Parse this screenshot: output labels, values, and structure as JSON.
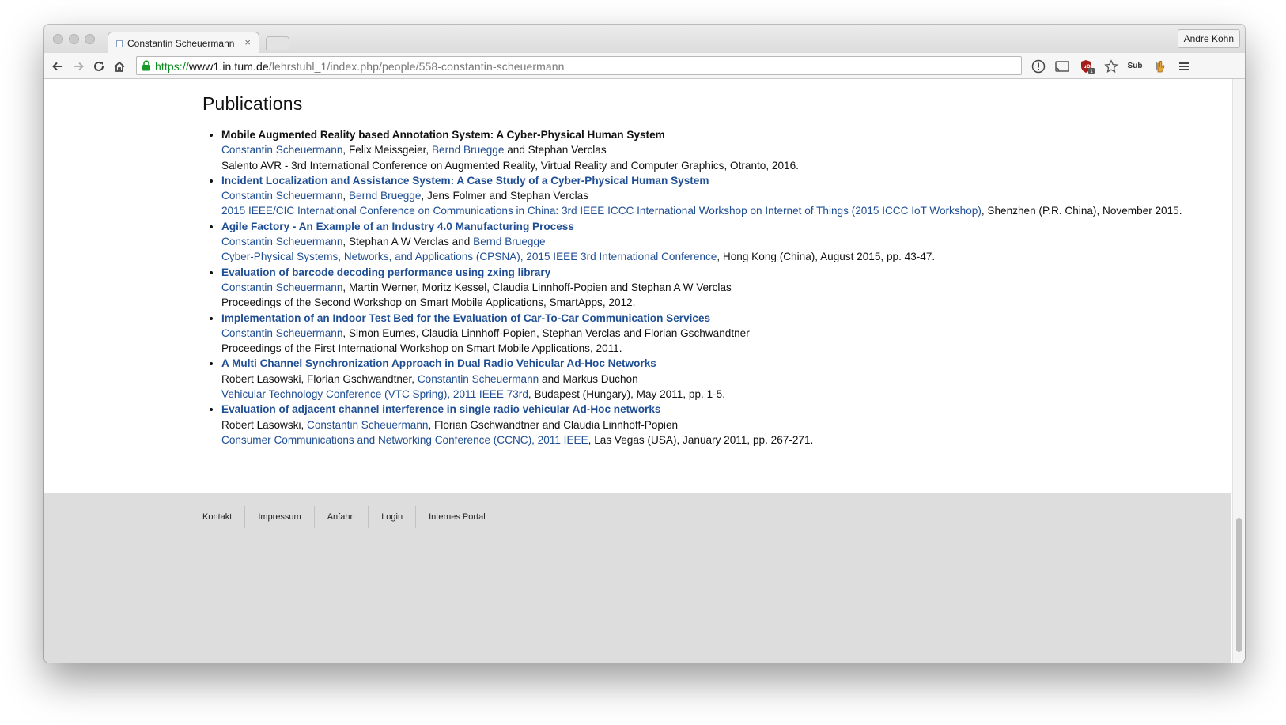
{
  "browser": {
    "tab_title": "Constantin Scheuermann",
    "tab_close": "×",
    "profile_name": "Andre Kohn",
    "url_scheme": "https://",
    "url_host": "www1.in.tum.de",
    "url_path": "/lehrstuhl_1/index.php/people/558-constantin-scheuermann",
    "extensions": [
      "info-icon",
      "cast-icon",
      "ublock-icon",
      "star-icon",
      "sub-icon",
      "hand-icon",
      "menu-icon"
    ],
    "ublock_badge": "1",
    "sub_label": "Sub"
  },
  "page": {
    "heading": "Publications",
    "publications": [
      {
        "title": "Mobile Augmented Reality based Annotation System: A Cyber-Physical Human System",
        "title_link": false,
        "authors": [
          {
            "text": "Constantin Scheuermann",
            "link": true
          },
          {
            "text": ", Felix Meissgeier, ",
            "link": false
          },
          {
            "text": "Bernd Bruegge",
            "link": true
          },
          {
            "text": " and Stephan Verclas",
            "link": false
          }
        ],
        "venue": [
          {
            "text": "Salento AVR - 3rd International Conference on Augmented Reality, Virtual Reality and Computer Graphics, Otranto, 2016.",
            "link": false
          }
        ]
      },
      {
        "title": "Incident Localization and Assistance System: A Case Study of a Cyber-Physical Human System",
        "title_link": true,
        "authors": [
          {
            "text": "Constantin Scheuermann",
            "link": true
          },
          {
            "text": ", ",
            "link": false
          },
          {
            "text": "Bernd Bruegge",
            "link": true
          },
          {
            "text": ", Jens Folmer and Stephan Verclas",
            "link": false
          }
        ],
        "venue": [
          {
            "text": "2015 IEEE/CIC International Conference on Communications in China: 3rd IEEE ICCC International Workshop on Internet of Things (2015 ICCC IoT Workshop)",
            "link": true
          },
          {
            "text": ", Shenzhen (P.R. China), November 2015.",
            "link": false
          }
        ]
      },
      {
        "title": "Agile Factory - An Example of an Industry 4.0 Manufacturing Process",
        "title_link": true,
        "authors": [
          {
            "text": "Constantin Scheuermann",
            "link": true
          },
          {
            "text": ", Stephan A W Verclas and ",
            "link": false
          },
          {
            "text": "Bernd Bruegge",
            "link": true
          }
        ],
        "venue": [
          {
            "text": "Cyber-Physical Systems, Networks, and Applications (CPSNA), 2015 IEEE 3rd International Conference",
            "link": true
          },
          {
            "text": ", Hong Kong (China), August 2015, pp. 43-47.",
            "link": false
          }
        ]
      },
      {
        "title": "Evaluation of barcode decoding performance using zxing library",
        "title_link": true,
        "authors": [
          {
            "text": "Constantin Scheuermann",
            "link": true
          },
          {
            "text": ", Martin Werner, Moritz Kessel, Claudia Linnhoff-Popien and Stephan A W Verclas",
            "link": false
          }
        ],
        "venue": [
          {
            "text": "Proceedings of the Second Workshop on Smart Mobile Applications, SmartApps, 2012.",
            "link": false
          }
        ]
      },
      {
        "title": "Implementation of an Indoor Test Bed for the Evaluation of Car-To-Car Communication Services",
        "title_link": true,
        "authors": [
          {
            "text": "Constantin Scheuermann",
            "link": true
          },
          {
            "text": ", Simon Eumes, Claudia Linnhoff-Popien, Stephan Verclas and Florian Gschwandtner",
            "link": false
          }
        ],
        "venue": [
          {
            "text": "Proceedings of the First International Workshop on Smart Mobile Applications, 2011.",
            "link": false
          }
        ]
      },
      {
        "title": "A Multi Channel Synchronization Approach in Dual Radio Vehicular Ad-Hoc Networks",
        "title_link": true,
        "authors": [
          {
            "text": "Robert Lasowski, Florian Gschwandtner, ",
            "link": false
          },
          {
            "text": "Constantin Scheuermann",
            "link": true
          },
          {
            "text": " and Markus Duchon",
            "link": false
          }
        ],
        "venue": [
          {
            "text": "Vehicular Technology Conference (VTC Spring), 2011 IEEE 73rd",
            "link": true
          },
          {
            "text": ", Budapest (Hungary), May 2011, pp. 1-5.",
            "link": false
          }
        ]
      },
      {
        "title": "Evaluation of adjacent channel interference in single radio vehicular Ad-Hoc networks",
        "title_link": true,
        "authors": [
          {
            "text": "Robert Lasowski, ",
            "link": false
          },
          {
            "text": "Constantin Scheuermann",
            "link": true
          },
          {
            "text": ", Florian Gschwandtner and Claudia Linnhoff-Popien",
            "link": false
          }
        ],
        "venue": [
          {
            "text": "Consumer Communications and Networking Conference (CCNC), 2011 IEEE",
            "link": true
          },
          {
            "text": ", Las Vegas (USA), January 2011, pp. 267-271.",
            "link": false
          }
        ]
      }
    ]
  },
  "footer": {
    "links": [
      "Kontakt",
      "Impressum",
      "Anfahrt",
      "Login",
      "Internes Portal"
    ]
  },
  "colors": {
    "link": "#1f4e94",
    "url_scheme": "#0b8a1f",
    "footer_bg": "#dddddd"
  }
}
